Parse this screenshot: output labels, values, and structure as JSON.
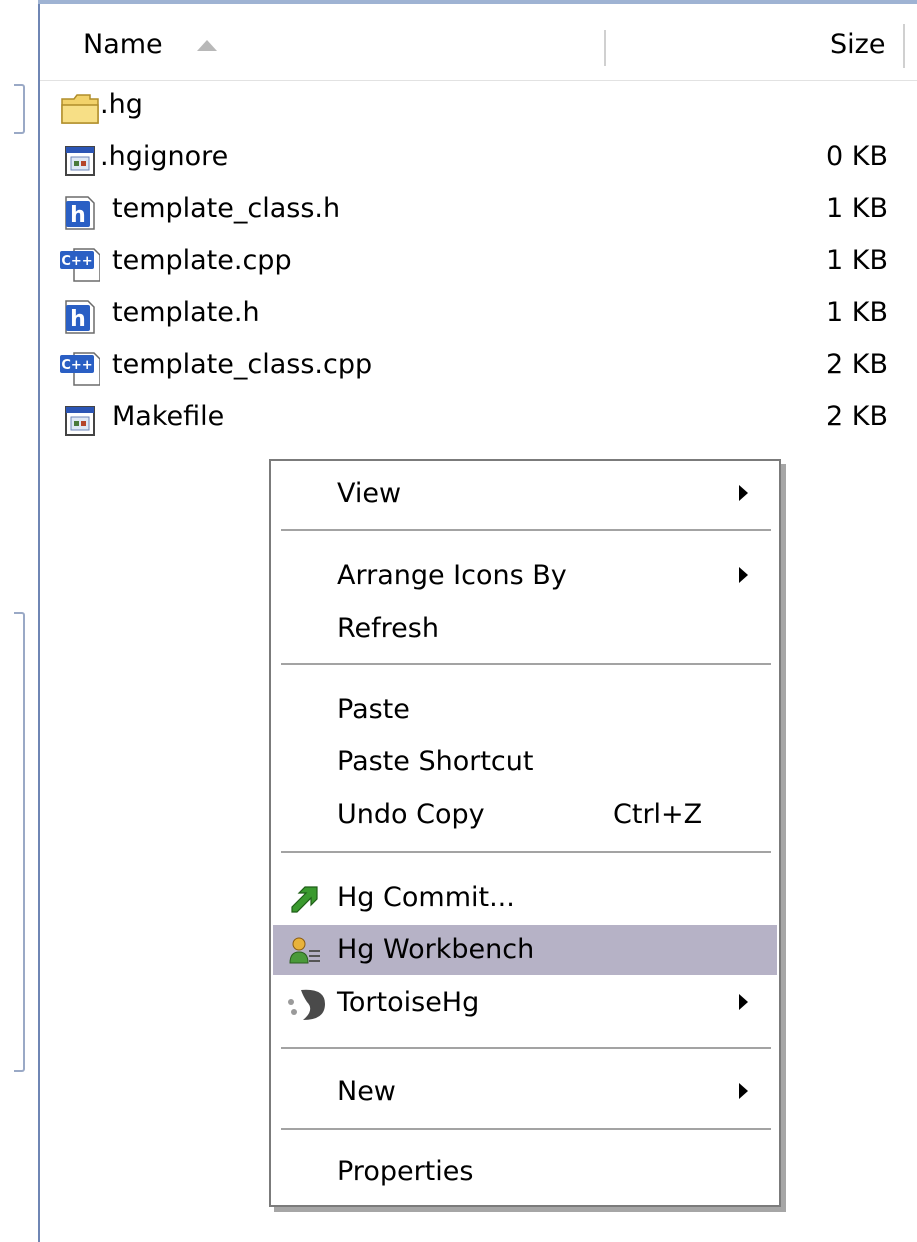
{
  "columns": {
    "name": "Name",
    "size": "Size"
  },
  "files": [
    {
      "name": ".hg",
      "size": "",
      "icon": "folder-icon"
    },
    {
      "name": ".hgignore",
      "size": "0 KB",
      "icon": "generic-file-icon"
    },
    {
      "name": "template_class.h",
      "size": "1 KB",
      "icon": "h-file-icon"
    },
    {
      "name": "template.cpp",
      "size": "1 KB",
      "icon": "cpp-file-icon"
    },
    {
      "name": "template.h",
      "size": "1 KB",
      "icon": "h-file-icon"
    },
    {
      "name": "template_class.cpp",
      "size": "2 KB",
      "icon": "cpp-file-icon"
    },
    {
      "name": "Makefile",
      "size": "2 KB",
      "icon": "generic-file-icon"
    }
  ],
  "context_menu": {
    "items": [
      {
        "label": "View",
        "submenu": true
      },
      {
        "label": "Arrange Icons By",
        "submenu": true
      },
      {
        "label": "Refresh"
      },
      {
        "label": "Paste"
      },
      {
        "label": "Paste Shortcut"
      },
      {
        "label": "Undo Copy",
        "shortcut": "Ctrl+Z"
      },
      {
        "label": "Hg Commit...",
        "icon": "hg-commit-icon"
      },
      {
        "label": "Hg Workbench",
        "icon": "hg-workbench-icon",
        "highlighted": true
      },
      {
        "label": "TortoiseHg",
        "icon": "tortoisehg-icon",
        "submenu": true
      },
      {
        "label": "New",
        "submenu": true
      },
      {
        "label": "Properties"
      }
    ]
  },
  "colors": {
    "highlight": "#b6b2c6",
    "border_accent": "#6f86b4"
  }
}
